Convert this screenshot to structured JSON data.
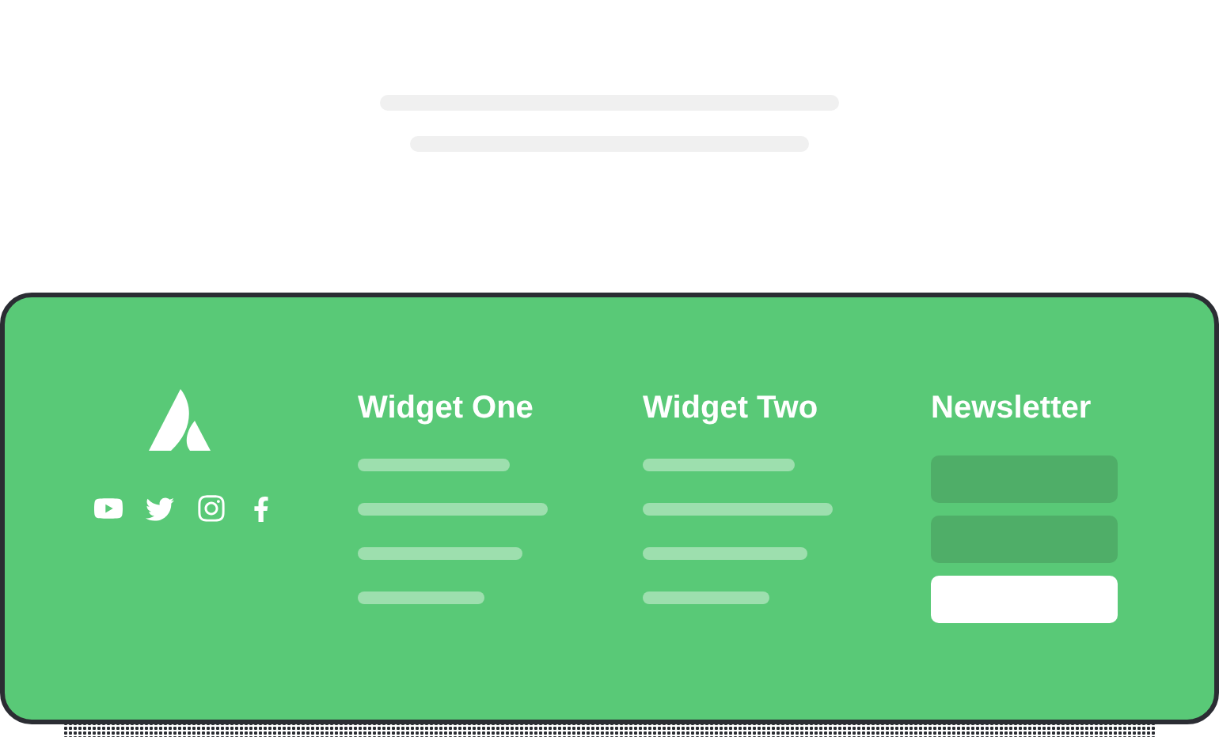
{
  "footer": {
    "widgets": [
      {
        "title": "Widget One"
      },
      {
        "title": "Widget Two"
      }
    ],
    "newsletter": {
      "title": "Newsletter"
    }
  }
}
